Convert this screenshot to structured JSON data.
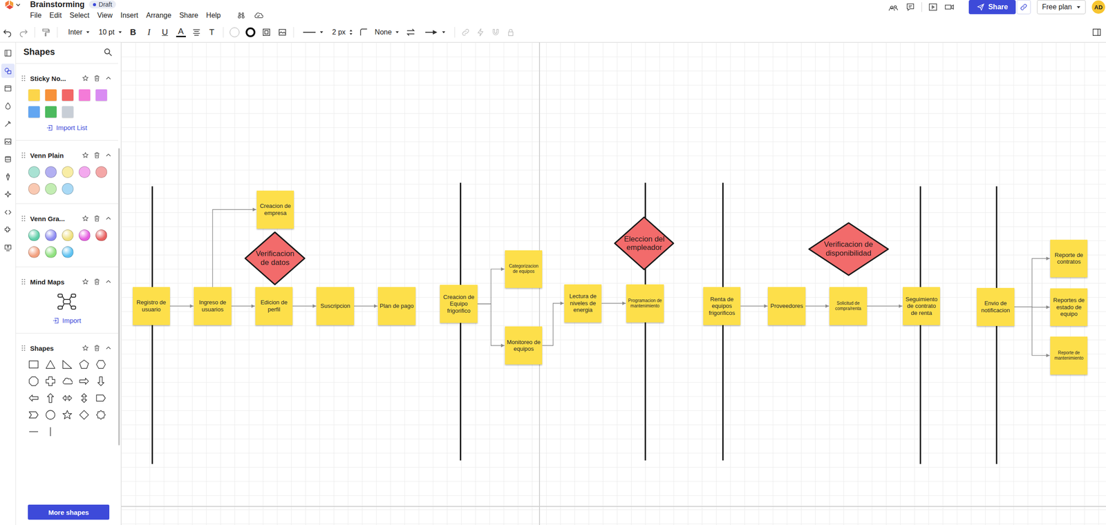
{
  "document": {
    "title": "Brainstorming",
    "status": "Draft"
  },
  "menu": [
    "File",
    "Edit",
    "Select",
    "View",
    "Insert",
    "Arrange",
    "Share",
    "Help"
  ],
  "topbar": {
    "share": "Share",
    "plan": "Free plan",
    "avatar": "AD"
  },
  "toolbar": {
    "font": "Inter",
    "font_size": "10 pt",
    "bold": "B",
    "italic": "I",
    "underline": "U",
    "text_color": "A",
    "text_menu": "T",
    "line_width": "2 px",
    "line_jump": "None"
  },
  "rail": [
    {
      "selected": false
    },
    {
      "selected": true
    },
    {
      "selected": false
    },
    {
      "selected": false
    },
    {
      "selected": false
    },
    {
      "selected": false
    },
    {
      "selected": false
    },
    {
      "selected": false
    },
    {
      "selected": false
    },
    {
      "selected": false
    },
    {
      "selected": false
    },
    {
      "selected": false
    }
  ],
  "panel": {
    "title": "Shapes",
    "sections": [
      {
        "title": "Sticky No...",
        "kind": "swatches",
        "expanded": true,
        "items": [
          {
            "color": "#fcd54a"
          },
          {
            "color": "#f7923a"
          },
          {
            "color": "#f26666"
          },
          {
            "color": "#f47bd8"
          },
          {
            "color": "#d98cf2"
          },
          {
            "color": "#63a6f1"
          },
          {
            "color": "#4cba5e"
          },
          {
            "color": "#c8ced6"
          }
        ],
        "action": "Import List"
      },
      {
        "title": "Venn Plain",
        "kind": "venn",
        "expanded": true,
        "items": [
          {
            "color": "#a9e2d3"
          },
          {
            "color": "#b3b0f2"
          },
          {
            "color": "#f8eda5"
          },
          {
            "color": "#f3a9ee"
          },
          {
            "color": "#f4a7a7"
          },
          {
            "color": "#f9c9b2"
          },
          {
            "color": "#c3edb3"
          },
          {
            "color": "#a9d9f5"
          }
        ]
      },
      {
        "title": "Venn Gra...",
        "kind": "venn-gradient",
        "expanded": true,
        "items": [
          {
            "color": "#5fcfa9"
          },
          {
            "color": "#8d8bf1"
          },
          {
            "color": "#efe07f"
          },
          {
            "color": "#e65ee0"
          },
          {
            "color": "#e86262"
          },
          {
            "color": "#f2a07f"
          },
          {
            "color": "#8fe07f"
          },
          {
            "color": "#5ec2f1"
          }
        ]
      },
      {
        "title": "Mind Maps",
        "kind": "mindmap",
        "expanded": true,
        "action": "Import"
      },
      {
        "title": "Shapes",
        "kind": "shapes",
        "expanded": true
      }
    ],
    "more_button": "More shapes"
  },
  "canvas": {
    "nodes": [
      {
        "label": "Registro de usuario",
        "kind": "sticky"
      },
      {
        "label": "Ingreso de usuarios",
        "kind": "sticky"
      },
      {
        "label": "Creacion de empresa",
        "kind": "sticky"
      },
      {
        "label": "Verificacion de datos",
        "kind": "decision"
      },
      {
        "label": "Edicion de perfil",
        "kind": "sticky"
      },
      {
        "label": "Suscripcion",
        "kind": "sticky"
      },
      {
        "label": "Plan de pago",
        "kind": "sticky"
      },
      {
        "label": "Creacion de Equipo frigorifico",
        "kind": "sticky"
      },
      {
        "label": "Categorizacion de equipos",
        "kind": "sticky"
      },
      {
        "label": "Monitoreo de equipos",
        "kind": "sticky"
      },
      {
        "label": "Lectura de niveles de energia",
        "kind": "sticky"
      },
      {
        "label": "Eleccion del empleador",
        "kind": "decision"
      },
      {
        "label": "Programacion de mantenimiento",
        "kind": "sticky"
      },
      {
        "label": "Renta de equipos frigorificos",
        "kind": "sticky"
      },
      {
        "label": "Verificacion de disponibilidad",
        "kind": "decision"
      },
      {
        "label": "Proveedores",
        "kind": "sticky"
      },
      {
        "label": "Solicitud de compra/renta",
        "kind": "sticky"
      },
      {
        "label": "Seguimiento de contrato de renta",
        "kind": "sticky"
      },
      {
        "label": "Envio de notificacion",
        "kind": "sticky"
      },
      {
        "label": "Reporte de contratos",
        "kind": "sticky"
      },
      {
        "label": "Reportes de estado de equipo",
        "kind": "sticky"
      },
      {
        "label": "Reporte de mantenimiento",
        "kind": "sticky"
      }
    ],
    "connectors": [
      {
        "from": "Registro de usuario",
        "to": "Ingreso de usuarios"
      },
      {
        "from": "Ingreso de usuarios",
        "to": "Creacion de empresa"
      },
      {
        "from": "Ingreso de usuarios",
        "to": "Edicion de perfil"
      },
      {
        "from": "Edicion de perfil",
        "to": "Suscripcion"
      },
      {
        "from": "Suscripcion",
        "to": "Plan de pago"
      },
      {
        "from": "Creacion de Equipo frigorifico",
        "to": "Categorizacion de equipos"
      },
      {
        "from": "Creacion de Equipo frigorifico",
        "to": "Monitoreo de equipos"
      },
      {
        "from": "Monitoreo de equipos",
        "to": "Lectura de niveles de energia"
      },
      {
        "from": "Lectura de niveles de energia",
        "to": "Programacion de mantenimiento"
      },
      {
        "from": "Renta de equipos frigorificos",
        "to": "Proveedores"
      },
      {
        "from": "Proveedores",
        "to": "Solicitud de compra/renta"
      },
      {
        "from": "Solicitud de compra/renta",
        "to": "Seguimiento de contrato de renta"
      },
      {
        "from": "Envio de notificacion",
        "to": "Reporte de contratos"
      },
      {
        "from": "Envio de notificacion",
        "to": "Reportes de estado de equipo"
      },
      {
        "from": "Envio de notificacion",
        "to": "Reporte de mantenimiento"
      }
    ]
  }
}
